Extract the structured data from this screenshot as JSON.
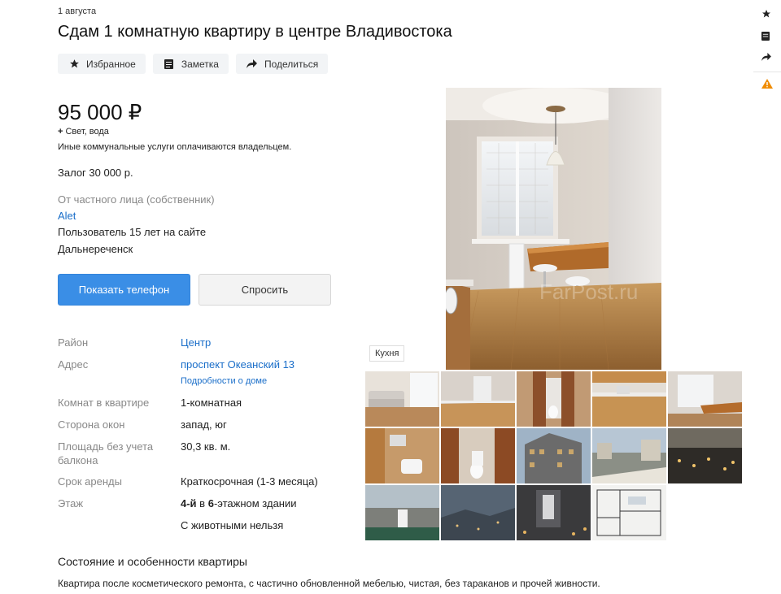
{
  "listing": {
    "date": "1 августа",
    "title": "Сдам 1 комнатную квартиру в центре Владивостока",
    "actions": {
      "favorite": "Избранное",
      "note": "Заметка",
      "share": "Поделиться"
    },
    "price": "95 000 ₽",
    "utilities": "Свет, вода",
    "utilities_note": "Иные коммунальные услуги оплачиваются владельцем.",
    "deposit": "Залог 30 000 р."
  },
  "seller": {
    "type": "От частного лица (собственник)",
    "name": "Alet",
    "since": "Пользователь 15 лет на сайте",
    "city": "Дальнереченск"
  },
  "buttons": {
    "show_phone": "Показать телефон",
    "ask": "Спросить"
  },
  "params": {
    "district_label": "Район",
    "district_value": "Центр",
    "address_label": "Адрес",
    "address_value": "проспект Океанский 13",
    "house_details": "Подробности о доме",
    "rooms_label": "Комнат в квартире",
    "rooms_value": "1-комнатная",
    "windows_label": "Сторона окон",
    "windows_value": "запад, юг",
    "area_label": "Площадь без учета балкона",
    "area_value": "30,3 кв. м.",
    "term_label": "Срок аренды",
    "term_value": "Краткосрочная (1-3 месяца)",
    "floor_label": "Этаж",
    "floor_num": "4-й",
    "floor_in": " в ",
    "floor_total": "6",
    "floor_suffix": "-этажном здании",
    "pets_value": "С животными нельзя"
  },
  "photo": {
    "caption": "Кухня",
    "watermark": "FarPost.ru"
  },
  "description": {
    "title": "Состояние и особенности квартиры",
    "text": "Квартира после косметического ремонта, с частично обновленной мебелью, чистая, без тараканов и прочей живности."
  },
  "icons": {
    "favorite": "star-icon",
    "note": "note-icon",
    "share": "share-arrow-icon",
    "warning": "warning-icon"
  },
  "colors": {
    "link": "#1a6ec9",
    "primary_button": "#3a8ee6",
    "warning": "#f08c00"
  }
}
